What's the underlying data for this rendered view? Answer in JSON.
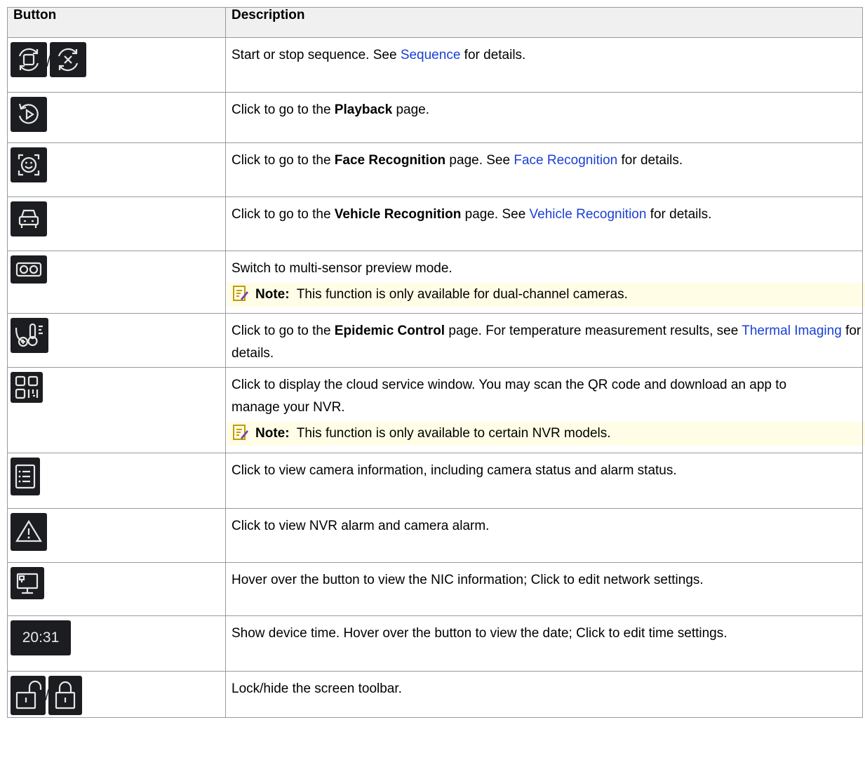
{
  "header": {
    "col1": "Button",
    "col2": "Description"
  },
  "rows": {
    "r0": {
      "pre": "Start or stop sequence. See ",
      "link": "Sequence",
      "post": " for details.",
      "sep": "/"
    },
    "r1": {
      "pre": "Click to go to the ",
      "bold": "Playback",
      "post": " page."
    },
    "r2": {
      "pre": "Click to go to the ",
      "bold": "Face Recognition",
      "mid": " page. See ",
      "link": "Face Recognition",
      "post": " for details."
    },
    "r3": {
      "pre": "Click to go to the ",
      "bold": "Vehicle Recognition",
      "mid": " page. See ",
      "link": "Vehicle Recognition",
      "post": " for details."
    },
    "r4": {
      "text": "Switch to multi-sensor preview mode.",
      "note_label": "Note:",
      "note_text": "This function is only available for dual-channel cameras."
    },
    "r5": {
      "pre": "Click to go to the ",
      "bold": "Epidemic Control",
      "mid": " page. For temperature measurement results, see ",
      "link": "Thermal Imaging",
      "post": " for details."
    },
    "r6": {
      "text": "Click to display the cloud service window. You may scan the QR code and download an app to manage your NVR.",
      "note_label": "Note:",
      "note_text": "This function is only available to certain NVR models."
    },
    "r7": {
      "text": "Click to view camera information, including camera status and alarm status."
    },
    "r8": {
      "text": "Click to view NVR alarm and camera alarm."
    },
    "r9": {
      "text": "Hover over the button to view the NIC information; Click to edit network settings."
    },
    "r10": {
      "time": "20:31",
      "text": "Show device time. Hover over the button to view the date; Click to edit time settings."
    },
    "r11": {
      "text": "Lock/hide the screen toolbar.",
      "sep": "/"
    }
  },
  "colors": {
    "link": "#1a3fd6",
    "note_bg": "#fffde6",
    "header_bg": "#f0f0f0",
    "icon_bg": "#1c1d20"
  }
}
